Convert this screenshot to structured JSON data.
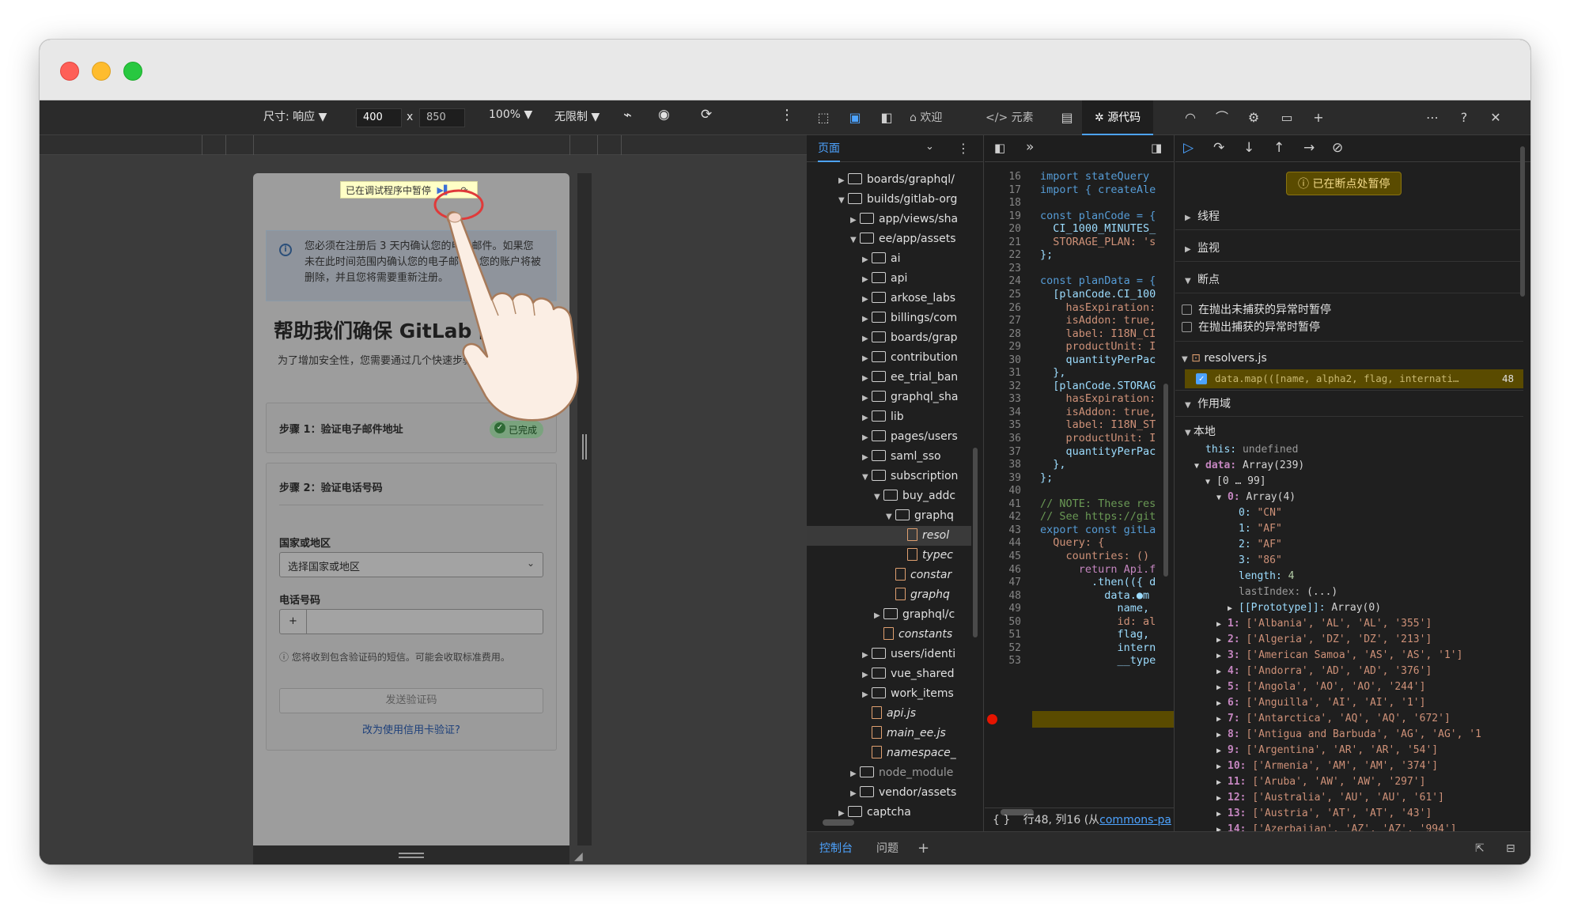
{
  "emulation": {
    "size_label": "尺寸: 响应",
    "width": "400",
    "times": "x",
    "height": "850",
    "zoom": "100%",
    "throttle": "无限制"
  },
  "page": {
    "paused_label": "已在调试程序中暂停",
    "alert_text": "您必须在注册后 3 天内确认您的电子邮件。如果您未在此时间范围内确认您的电子邮件，您的账户将被删除，并且您将需要重新注册。",
    "headline": "帮助我们确保 GitLab 的安全",
    "subtitle": "为了增加安全性，您需要通过几个快速步骤验证您的身份。",
    "step1_title": "步骤 1：验证电子邮件地址",
    "step1_badge": "已完成",
    "step2_title": "步骤 2：验证电话号码",
    "country_label": "国家或地区",
    "country_placeholder": "选择国家或地区",
    "phone_label": "电话号码",
    "phone_prefix": "+",
    "hint": "您将收到包含验证码的短信。可能会收取标准费用。",
    "send_button": "发送验证码",
    "alt_link": "改为使用信用卡验证?"
  },
  "devtools": {
    "tabs": [
      "欢迎",
      "元素",
      "源代码"
    ],
    "active_tab": "源代码",
    "navigator_tab": "页面",
    "tree": [
      {
        "label": "boards/graphql/",
        "type": "folder",
        "indent": 0,
        "expanded": false
      },
      {
        "label": "builds/gitlab-org",
        "type": "folder",
        "indent": 0,
        "expanded": true
      },
      {
        "label": "app/views/sha",
        "type": "folder",
        "indent": 1,
        "expanded": false
      },
      {
        "label": "ee/app/assets",
        "type": "folder",
        "indent": 1,
        "expanded": true
      },
      {
        "label": "ai",
        "type": "folder",
        "indent": 2,
        "expanded": false
      },
      {
        "label": "api",
        "type": "folder",
        "indent": 2,
        "expanded": false
      },
      {
        "label": "arkose_labs",
        "type": "folder",
        "indent": 2,
        "expanded": false
      },
      {
        "label": "billings/com",
        "type": "folder",
        "indent": 2,
        "expanded": false
      },
      {
        "label": "boards/grap",
        "type": "folder",
        "indent": 2,
        "expanded": false
      },
      {
        "label": "contribution",
        "type": "folder",
        "indent": 2,
        "expanded": false
      },
      {
        "label": "ee_trial_ban",
        "type": "folder",
        "indent": 2,
        "expanded": false
      },
      {
        "label": "graphql_sha",
        "type": "folder",
        "indent": 2,
        "expanded": false
      },
      {
        "label": "lib",
        "type": "folder",
        "indent": 2,
        "expanded": false
      },
      {
        "label": "pages/users",
        "type": "folder",
        "indent": 2,
        "expanded": false
      },
      {
        "label": "saml_sso",
        "type": "folder",
        "indent": 2,
        "expanded": false
      },
      {
        "label": "subscription",
        "type": "folder",
        "indent": 2,
        "expanded": true
      },
      {
        "label": "buy_addc",
        "type": "folder",
        "indent": 3,
        "expanded": true
      },
      {
        "label": "graphq",
        "type": "folder",
        "indent": 4,
        "expanded": true
      },
      {
        "label": "resol",
        "type": "file",
        "indent": 5,
        "selected": true
      },
      {
        "label": "typec",
        "type": "file",
        "indent": 5
      },
      {
        "label": "constar",
        "type": "file",
        "indent": 4
      },
      {
        "label": "graphq",
        "type": "file",
        "indent": 4
      },
      {
        "label": "graphql/c",
        "type": "folder",
        "indent": 3,
        "expanded": false
      },
      {
        "label": "constants",
        "type": "file",
        "indent": 3
      },
      {
        "label": "users/identi",
        "type": "folder",
        "indent": 2,
        "expanded": false
      },
      {
        "label": "vue_shared",
        "type": "folder",
        "indent": 2,
        "expanded": false
      },
      {
        "label": "work_items",
        "type": "folder",
        "indent": 2,
        "expanded": false
      },
      {
        "label": "api.js",
        "type": "file",
        "indent": 2
      },
      {
        "label": "main_ee.js",
        "type": "file",
        "indent": 2
      },
      {
        "label": "namespace_",
        "type": "file",
        "indent": 2
      },
      {
        "label": "node_module",
        "type": "folder",
        "indent": 1,
        "expanded": false,
        "dim": true
      },
      {
        "label": "vendor/assets",
        "type": "folder",
        "indent": 1,
        "expanded": false
      },
      {
        "label": "captcha",
        "type": "folder",
        "indent": 0,
        "expanded": false
      }
    ],
    "code_lines": [
      {
        "n": "16",
        "t": "import stateQuery"
      },
      {
        "n": "17",
        "t": "import { createAle"
      },
      {
        "n": "18",
        "t": ""
      },
      {
        "n": "19",
        "t": "const planCode = {"
      },
      {
        "n": "20",
        "t": "  CI_1000_MINUTES_"
      },
      {
        "n": "21",
        "t": "  STORAGE_PLAN: 's"
      },
      {
        "n": "22",
        "t": "};"
      },
      {
        "n": "23",
        "t": ""
      },
      {
        "n": "24",
        "t": "const planData = {"
      },
      {
        "n": "25",
        "t": "  [planCode.CI_100"
      },
      {
        "n": "26",
        "t": "    hasExpiration:"
      },
      {
        "n": "27",
        "t": "    isAddon: true,"
      },
      {
        "n": "28",
        "t": "    label: I18N_CI"
      },
      {
        "n": "29",
        "t": "    productUnit: I"
      },
      {
        "n": "30",
        "t": "    quantityPerPac"
      },
      {
        "n": "31",
        "t": "  },"
      },
      {
        "n": "32",
        "t": "  [planCode.STORAG"
      },
      {
        "n": "33",
        "t": "    hasExpiration:"
      },
      {
        "n": "34",
        "t": "    isAddon: true,"
      },
      {
        "n": "35",
        "t": "    label: I18N_ST"
      },
      {
        "n": "36",
        "t": "    productUnit: I"
      },
      {
        "n": "37",
        "t": "    quantityPerPac"
      },
      {
        "n": "38",
        "t": "  },"
      },
      {
        "n": "39",
        "t": "};"
      },
      {
        "n": "40",
        "t": ""
      },
      {
        "n": "41",
        "t": "// NOTE: These res"
      },
      {
        "n": "42",
        "t": "// See https://git"
      },
      {
        "n": "43",
        "t": "export const gitLa"
      },
      {
        "n": "44",
        "t": "  Query: {"
      },
      {
        "n": "45",
        "t": "    countries: ()"
      },
      {
        "n": "46",
        "t": "      return Api.f"
      },
      {
        "n": "47",
        "t": "        .then(({ d"
      },
      {
        "n": "48",
        "t": "          data.●m"
      },
      {
        "n": "49",
        "t": "            name,"
      },
      {
        "n": "50",
        "t": "            id: al"
      },
      {
        "n": "51",
        "t": "            flag,"
      },
      {
        "n": "52",
        "t": "            intern"
      },
      {
        "n": "53",
        "t": "            __type"
      }
    ],
    "status": "行48, 列16 (从",
    "status_link": "commons-pa",
    "paused_banner": "已在断点处暂停",
    "sections": {
      "threads": "线程",
      "watch": "监视",
      "breakpoints": "断点",
      "pause_uncaught": "在抛出未捕获的异常时暂停",
      "pause_caught": "在抛出捕获的异常时暂停",
      "bp_file": "resolvers.js",
      "bp_code": "data.map(([name, alpha2, flag, internati…",
      "bp_line": "48",
      "scope": "作用域",
      "local": "本地"
    },
    "scope": {
      "this_row": {
        "k": "this:",
        "v": "undefined"
      },
      "data_row": {
        "k": "data:",
        "v": "Array(239)"
      },
      "range_row": "[0 … 99]",
      "first_row": {
        "k": "0:",
        "v": "Array(4)"
      },
      "first_items": [
        {
          "k": "0:",
          "v": "\"CN\""
        },
        {
          "k": "1:",
          "v": "\"AF\""
        },
        {
          "k": "2:",
          "v": "\"AF\""
        },
        {
          "k": "3:",
          "v": "\"86\""
        }
      ],
      "length_row": {
        "k": "length:",
        "v": "4"
      },
      "lastindex_row": {
        "k": "lastIndex:",
        "v": "(...)"
      },
      "proto_row": {
        "k": "[[Prototype]]:",
        "v": "Array(0)"
      },
      "items": [
        {
          "k": "1:",
          "v": "['Albania', 'AL', 'AL', '355']"
        },
        {
          "k": "2:",
          "v": "['Algeria', 'DZ', 'DZ', '213']"
        },
        {
          "k": "3:",
          "v": "['American Samoa', 'AS', 'AS', '1']"
        },
        {
          "k": "4:",
          "v": "['Andorra', 'AD', 'AD', '376']"
        },
        {
          "k": "5:",
          "v": "['Angola', 'AO', 'AO', '244']"
        },
        {
          "k": "6:",
          "v": "['Anguilla', 'AI', 'AI', '1']"
        },
        {
          "k": "7:",
          "v": "['Antarctica', 'AQ', 'AQ', '672']"
        },
        {
          "k": "8:",
          "v": "['Antigua and Barbuda', 'AG', 'AG', '1"
        },
        {
          "k": "9:",
          "v": "['Argentina', 'AR', 'AR', '54']"
        },
        {
          "k": "10:",
          "v": "['Armenia', 'AM', 'AM', '374']"
        },
        {
          "k": "11:",
          "v": "['Aruba', 'AW', 'AW', '297']"
        },
        {
          "k": "12:",
          "v": "['Australia', 'AU', 'AU', '61']"
        },
        {
          "k": "13:",
          "v": "['Austria', 'AT', 'AT', '43']"
        },
        {
          "k": "14:",
          "v": "['Azerbaijan', 'AZ', 'AZ', '994']"
        }
      ]
    },
    "bottom_tabs": [
      "控制台",
      "问题"
    ]
  }
}
